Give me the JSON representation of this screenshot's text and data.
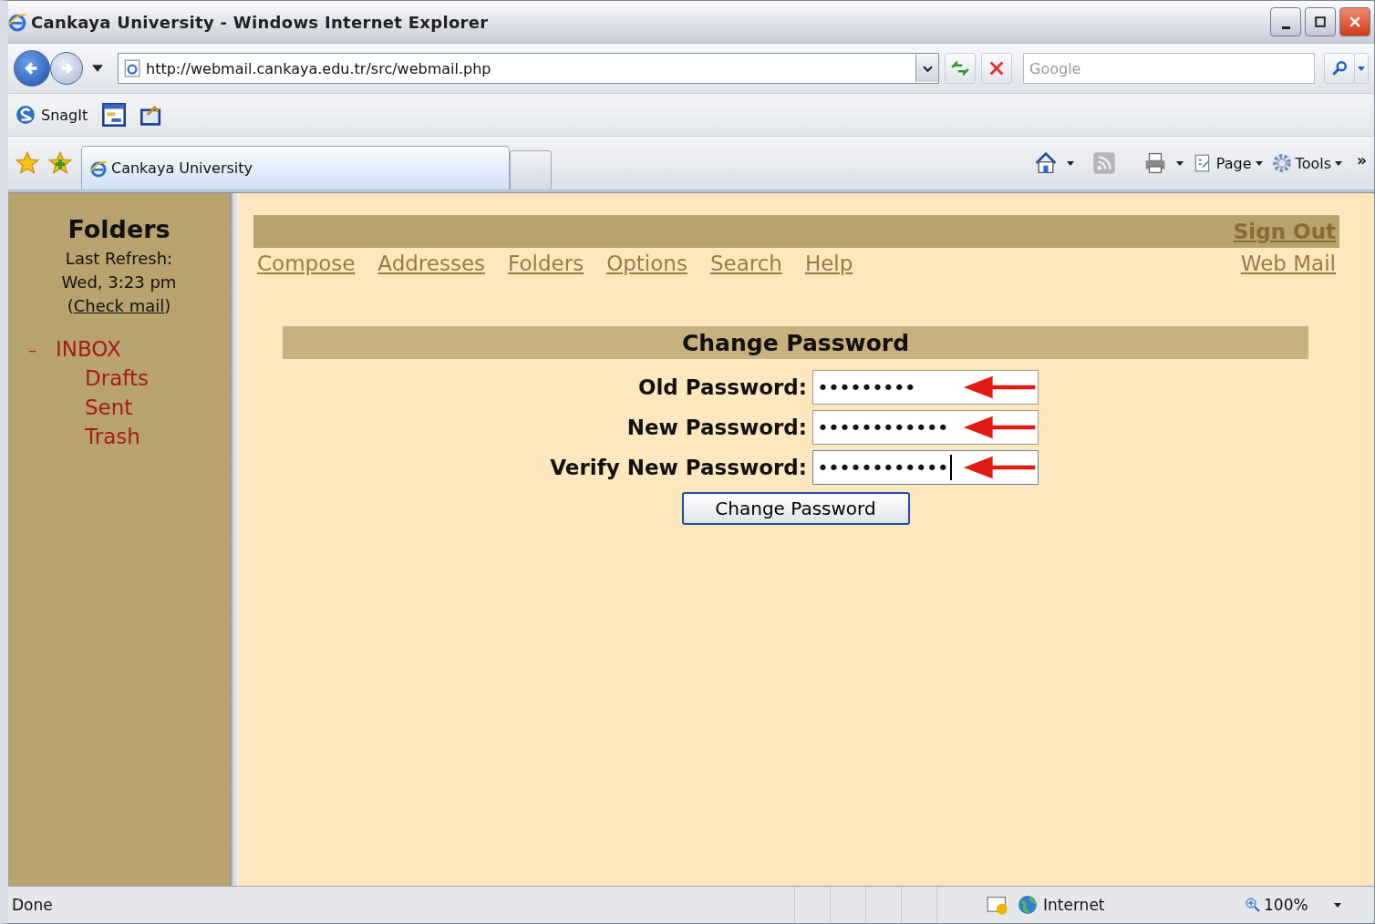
{
  "window": {
    "title": "Cankaya University - Windows Internet Explorer"
  },
  "address_bar": {
    "url": "http://webmail.cankaya.edu.tr/src/webmail.php",
    "search_placeholder": "Google"
  },
  "links_bar": {
    "items": [
      {
        "label": "SnagIt"
      }
    ]
  },
  "tabs": [
    {
      "label": "Cankaya University",
      "selected": true
    }
  ],
  "command_bar": {
    "items": [
      {
        "label": "Page"
      },
      {
        "label": "Tools"
      }
    ],
    "overflow": "»"
  },
  "sidebar": {
    "heading": "Folders",
    "refresh_label": "Last Refresh:",
    "refresh_time": "Wed, 3:23 pm",
    "check_mail": {
      "before": "(",
      "link": "Check mail",
      "after": ")"
    },
    "folders": [
      {
        "name": "INBOX",
        "toggle": "–",
        "children": [
          {
            "name": "Drafts"
          },
          {
            "name": "Sent"
          },
          {
            "name": "Trash"
          }
        ]
      }
    ]
  },
  "main": {
    "sign_out": "Sign Out",
    "nav": [
      "Compose",
      "Addresses",
      "Folders",
      "Options",
      "Search",
      "Help"
    ],
    "home_link": "Web Mail",
    "form": {
      "title": "Change Password",
      "fields": [
        {
          "label": "Old Password:",
          "value": "•••••••••",
          "focused": false
        },
        {
          "label": "New Password:",
          "value": "••••••••••••",
          "focused": false
        },
        {
          "label": "Verify New Password:",
          "value": "••••••••••••",
          "focused": true
        }
      ],
      "button": "Change Password"
    }
  },
  "status_bar": {
    "text": "Done",
    "zone": "Internet",
    "zoom": "100%"
  }
}
